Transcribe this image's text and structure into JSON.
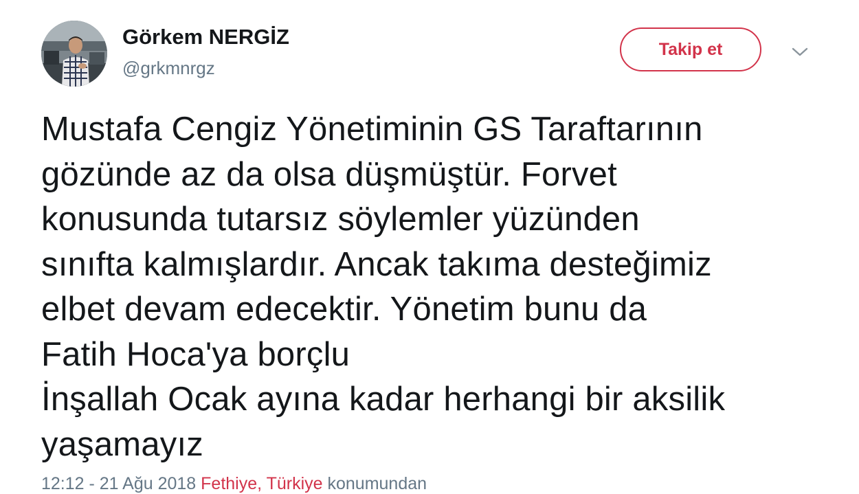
{
  "user": {
    "display_name": "Görkem NERGİZ",
    "handle": "@grkmnrgz"
  },
  "actions": {
    "follow_label": "Takip et",
    "menu_icon": "chevron-down-icon"
  },
  "tweet": {
    "lines": [
      "Mustafa Cengiz Yönetiminin GS Taraftarının",
      "gözünde az da olsa düşmüştür. Forvet",
      "konusunda tutarsız söylemler yüzünden",
      "sınıfta kalmışlardır. Ancak takıma desteğimiz",
      "elbet devam edecektir. Yönetim bunu da",
      "Fatih Hoca'ya borçlu",
      "İnşallah Ocak ayına kadar herhangi bir aksilik",
      "yaşamayız"
    ]
  },
  "meta": {
    "time": "12:12",
    "separator": " - ",
    "date": "21 Ağu 2018",
    "location": "Fethiye, Türkiye",
    "location_suffix": " konumundan"
  },
  "colors": {
    "accent": "#d2334a",
    "text": "#14171a",
    "secondary": "#657786"
  }
}
